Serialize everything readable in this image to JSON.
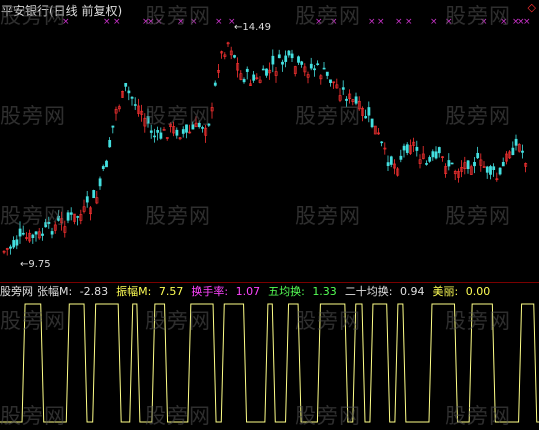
{
  "header": {
    "title": "平安银行(日线 前复权)",
    "corner_icon": "diamond-icon"
  },
  "watermark": "股旁网",
  "price_marks": {
    "high": "14.49",
    "low": "9.75"
  },
  "indicator": {
    "name": "股旁网",
    "items": [
      {
        "label": "张幅M:",
        "value": "-2.83",
        "color": "#e0e0e0"
      },
      {
        "label": "振幅M:",
        "value": "7.57",
        "color": "#ffff55"
      },
      {
        "label": "换手率:",
        "value": "1.07",
        "color": "#ff44ff"
      },
      {
        "label": "五均换:",
        "value": "1.33",
        "color": "#55ff55"
      },
      {
        "label": "二十均换:",
        "value": "0.94",
        "color": "#e0e0e0"
      },
      {
        "label": "美丽:",
        "value": "0.00",
        "color": "#ffff55"
      }
    ]
  },
  "colors": {
    "up": "#ff3333",
    "down": "#44e0e0",
    "line": "#ffff88",
    "marker": "#cc33cc"
  }
}
